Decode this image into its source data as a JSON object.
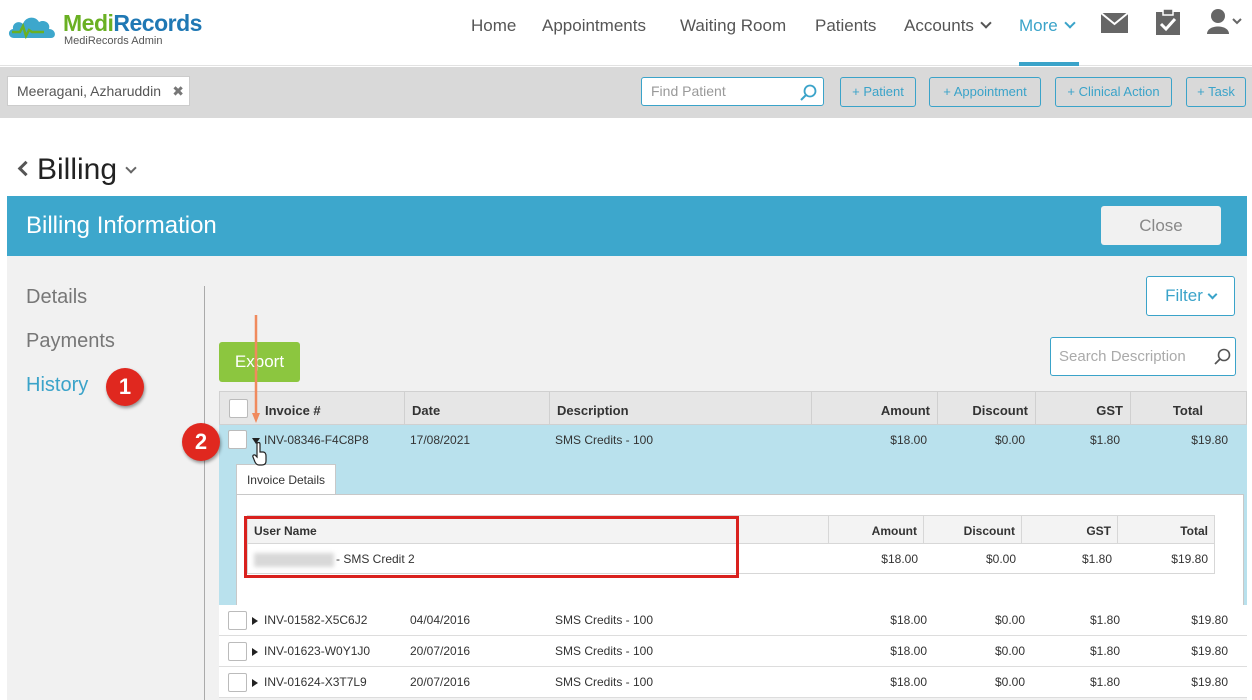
{
  "app": {
    "brand": "MediRecords",
    "brand_prefix": "Medi",
    "brand_suffix": "Records",
    "subtitle": "MediRecords Admin"
  },
  "nav": {
    "items": [
      {
        "label": "Home"
      },
      {
        "label": "Appointments"
      },
      {
        "label": "Waiting Room"
      },
      {
        "label": "Patients"
      },
      {
        "label": "Accounts"
      },
      {
        "label": "More"
      }
    ],
    "icons": [
      "mail-icon",
      "clipboard-check-icon",
      "user-icon"
    ]
  },
  "patient_bar": {
    "patient_name": "Meeragani, Azharuddin",
    "find_placeholder": "Find Patient",
    "buttons": [
      "+ Patient",
      "+ Appointment",
      "+ Clinical Action",
      "+ Task"
    ]
  },
  "page": {
    "title": "Billing"
  },
  "billing": {
    "header": "Billing Information",
    "close_label": "Close",
    "sidebar": [
      "Details",
      "Payments",
      "History"
    ],
    "filter_label": "Filter",
    "export_label": "Export",
    "search_placeholder": "Search Description"
  },
  "badges": [
    "1",
    "2"
  ],
  "table": {
    "columns": [
      "Invoice #",
      "Date",
      "Description",
      "Amount",
      "Discount",
      "GST",
      "Total"
    ],
    "expanded_row": {
      "invoice": "INV-08346-F4C8P8",
      "date": "17/08/2021",
      "description": "SMS Credits - 100",
      "amount": "$18.00",
      "discount": "$0.00",
      "gst": "$1.80",
      "total": "$19.80"
    },
    "details": {
      "tab_label": "Invoice Details",
      "columns": [
        "User Name",
        "Amount",
        "Discount",
        "GST",
        "Total"
      ],
      "row": {
        "user_suffix": "- SMS Credit 2",
        "amount": "$18.00",
        "discount": "$0.00",
        "gst": "$1.80",
        "total": "$19.80"
      }
    },
    "rows": [
      {
        "invoice": "INV-01582-X5C6J2",
        "date": "04/04/2016",
        "description": "SMS Credits - 100",
        "amount": "$18.00",
        "discount": "$0.00",
        "gst": "$1.80",
        "total": "$19.80"
      },
      {
        "invoice": "INV-01623-W0Y1J0",
        "date": "20/07/2016",
        "description": "SMS Credits - 100",
        "amount": "$18.00",
        "discount": "$0.00",
        "gst": "$1.80",
        "total": "$19.80"
      },
      {
        "invoice": "INV-01624-X3T7L9",
        "date": "20/07/2016",
        "description": "SMS Credits - 100",
        "amount": "$18.00",
        "discount": "$0.00",
        "gst": "$1.80",
        "total": "$19.80"
      }
    ]
  },
  "colors": {
    "accent": "#3aa3c9",
    "header_bg": "#3da7cc",
    "export_green": "#8cc63f",
    "badge_red": "#e0281f",
    "highlight_red": "#d9211e",
    "expanded_row_bg": "#b9e1ed"
  }
}
